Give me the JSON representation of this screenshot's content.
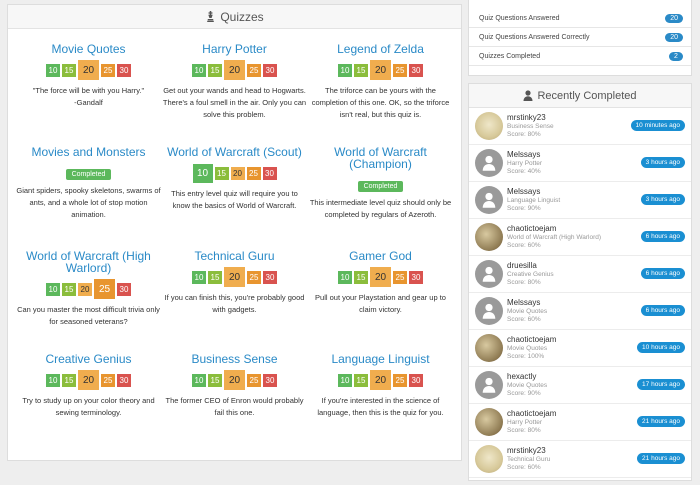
{
  "quizzes_panel": {
    "title": "Quizzes"
  },
  "quizzes": [
    {
      "title": "Movie Quotes",
      "levels": [
        "10",
        "15",
        "20",
        "25",
        "30"
      ],
      "desc": "\"The force will be with you Harry.\"\n-Gandalf"
    },
    {
      "title": "Harry Potter",
      "levels": [
        "10",
        "15",
        "20",
        "25",
        "30"
      ],
      "desc": "Get out your wands and head to Hogwarts. There's a foul smell in the air. Only you can solve this problem."
    },
    {
      "title": "Legend of Zelda",
      "levels": [
        "10",
        "15",
        "20",
        "25",
        "30"
      ],
      "desc": "The triforce can be yours with the completion of this one. OK, so the triforce isn't real, but this quiz is."
    },
    {
      "title": "Movies and Monsters",
      "completed": "Completed",
      "desc": "Giant spiders, spooky skeletons, swarms of ants, and a whole lot of stop motion animation."
    },
    {
      "title": "World of Warcraft (Scout)",
      "levels": [
        "10",
        "15",
        "20",
        "25",
        "30"
      ],
      "desc": "This entry level quiz will require you to know the basics of World of Warcraft."
    },
    {
      "title": "World of Warcraft (Champion)",
      "completed": "Completed",
      "desc": "This intermediate level quiz should only be completed by regulars of Azeroth."
    },
    {
      "title": "World of Warcraft (High Warlord)",
      "levels": [
        "10",
        "15",
        "20",
        "25",
        "30"
      ],
      "desc": "Can you master the most difficult trivia only for seasoned veterans?"
    },
    {
      "title": "Technical Guru",
      "levels": [
        "10",
        "15",
        "20",
        "25",
        "30"
      ],
      "desc": "If you can finish this, you're probably good with gadgets."
    },
    {
      "title": "Gamer God",
      "levels": [
        "10",
        "15",
        "20",
        "25",
        "30"
      ],
      "desc": "Pull out your Playstation and gear up to claim victory."
    },
    {
      "title": "Creative Genius",
      "levels": [
        "10",
        "15",
        "20",
        "25",
        "30"
      ],
      "desc": "Try to study up on your color theory and sewing terminology."
    },
    {
      "title": "Business Sense",
      "levels": [
        "10",
        "15",
        "20",
        "25",
        "30"
      ],
      "desc": "The former CEO of Enron would probably fail this one."
    },
    {
      "title": "Language Linguist",
      "levels": [
        "10",
        "15",
        "20",
        "25",
        "30"
      ],
      "desc": "If you're interested in the science of language, then this is the quiz for you."
    }
  ],
  "stats": [
    {
      "label": "Quiz Questions Answered",
      "count": "20"
    },
    {
      "label": "Quiz Questions Answered Correctly",
      "count": "20"
    },
    {
      "label": "Quizzes Completed",
      "count": "2"
    }
  ],
  "recent_panel": {
    "title": "Recently Completed"
  },
  "recent": [
    {
      "user": "mrstinky23",
      "quiz": "Business Sense",
      "score": "Score: 80%",
      "time": "10 minutes ago",
      "avatar": "map"
    },
    {
      "user": "Melssays",
      "quiz": "Harry Potter",
      "score": "Score: 40%",
      "time": "3 hours ago",
      "avatar": "default"
    },
    {
      "user": "Melssays",
      "quiz": "Language Linguist",
      "score": "Score: 90%",
      "time": "3 hours ago",
      "avatar": "default"
    },
    {
      "user": "chaotictoejam",
      "quiz": "World of Warcraft (High Warlord)",
      "score": "Score: 60%",
      "time": "6 hours ago",
      "avatar": "photo"
    },
    {
      "user": "druesilla",
      "quiz": "Creative Genius",
      "score": "Score: 80%",
      "time": "6 hours ago",
      "avatar": "default"
    },
    {
      "user": "Melssays",
      "quiz": "Movie Quotes",
      "score": "Score: 60%",
      "time": "6 hours ago",
      "avatar": "default"
    },
    {
      "user": "chaotictoejam",
      "quiz": "Movie Quotes",
      "score": "Score: 100%",
      "time": "10 hours ago",
      "avatar": "photo"
    },
    {
      "user": "hexactly",
      "quiz": "Movie Quotes",
      "score": "Score: 90%",
      "time": "17 hours ago",
      "avatar": "default"
    },
    {
      "user": "chaotictoejam",
      "quiz": "Harry Potter",
      "score": "Score: 80%",
      "time": "21 hours ago",
      "avatar": "photo"
    },
    {
      "user": "mrstinky23",
      "quiz": "Technical Guru",
      "score": "Score: 60%",
      "time": "21 hours ago",
      "avatar": "map"
    }
  ]
}
